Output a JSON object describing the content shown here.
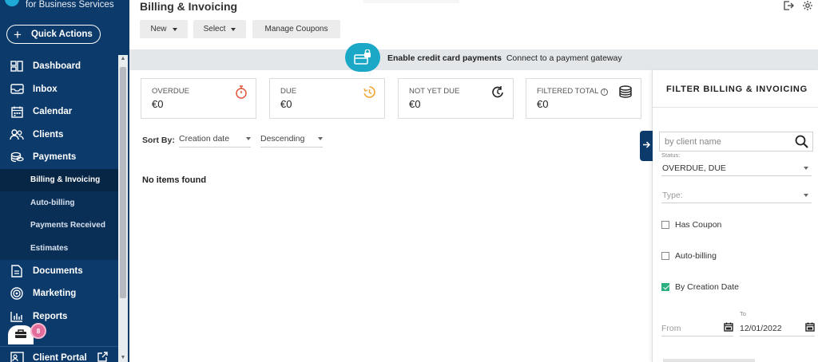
{
  "sidebar": {
    "brand_text": "for Business Services",
    "quick_actions_label": "Quick Actions",
    "items": [
      {
        "label": "Dashboard",
        "icon": "dashboard-icon"
      },
      {
        "label": "Inbox",
        "icon": "inbox-icon"
      },
      {
        "label": "Calendar",
        "icon": "calendar-icon"
      },
      {
        "label": "Clients",
        "icon": "clients-icon"
      },
      {
        "label": "Payments",
        "icon": "payments-icon"
      }
    ],
    "sub_items": [
      {
        "label": "Billing & Invoicing",
        "active": true
      },
      {
        "label": "Auto-billing"
      },
      {
        "label": "Payments Received"
      },
      {
        "label": "Estimates"
      }
    ],
    "items_after": [
      {
        "label": "Documents",
        "icon": "documents-icon"
      },
      {
        "label": "Marketing",
        "icon": "marketing-icon"
      },
      {
        "label": "Reports",
        "icon": "reports-icon"
      }
    ],
    "client_portal_label": "Client Portal",
    "badge_count": "8"
  },
  "header": {
    "title": "Billing & Invoicing",
    "toolbar": {
      "new_label": "New",
      "select_label": "Select",
      "manage_coupons_label": "Manage Coupons"
    }
  },
  "banner": {
    "bold_text": "Enable credit card payments",
    "text": "Connect to a payment gateway"
  },
  "summary_cards": [
    {
      "label": "OVERDUE",
      "value": "€0",
      "icon": "stopwatch-icon",
      "color": "#e0563b"
    },
    {
      "label": "DUE",
      "value": "€0",
      "icon": "clock-due-icon",
      "color": "#f0a531"
    },
    {
      "label": "NOT YET DUE",
      "value": "€0",
      "icon": "clock-refresh-icon",
      "color": "#222222"
    },
    {
      "label": "FILTERED TOTAL",
      "value": "€0",
      "icon": "coins-stack-icon",
      "color": "#222222"
    }
  ],
  "sort": {
    "label": "Sort By:",
    "field": "Creation date",
    "order": "Descending"
  },
  "empty_message": "No items found",
  "filter_panel": {
    "title": "FILTER BILLING & INVOICING",
    "search_placeholder": "by client name",
    "status_label": "Status:",
    "status_value": "OVERDUE, DUE",
    "type_placeholder": "Type:",
    "has_coupon_label": "Has Coupon",
    "has_coupon_checked": false,
    "auto_billing_label": "Auto-billing",
    "auto_billing_checked": false,
    "by_creation_date_label": "By Creation Date",
    "by_creation_date_checked": true,
    "from_placeholder": "From",
    "to_label": "To",
    "to_value": "12/01/2022"
  },
  "colors": {
    "sidebar_bg": "#0c3a6b",
    "accent_teal": "#1ba7c6",
    "check_green": "#2bb07f"
  }
}
